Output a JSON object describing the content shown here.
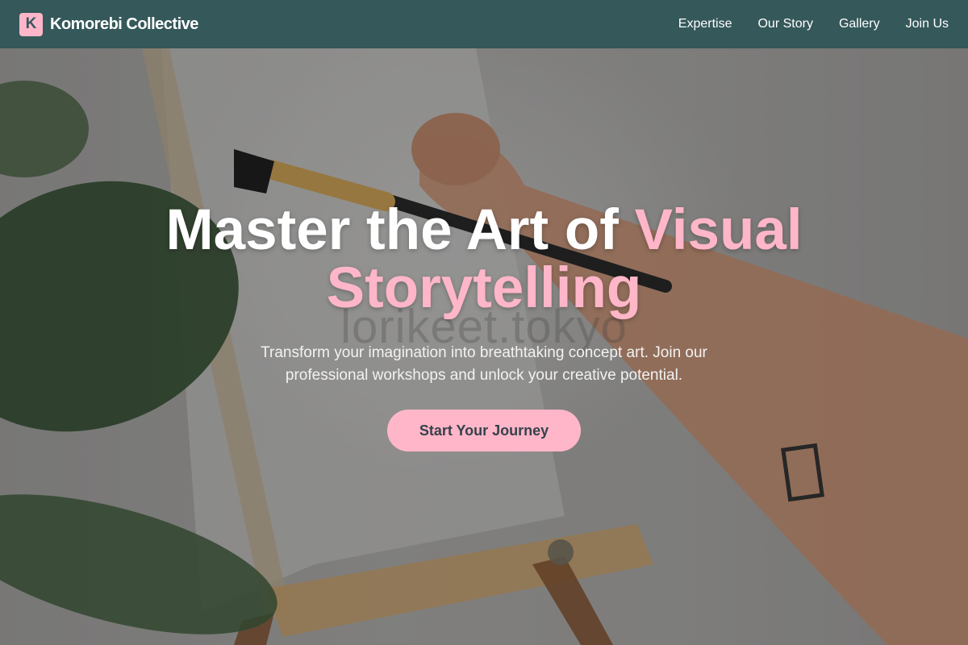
{
  "brand": {
    "badge_letter": "K",
    "name": "Komorebi Collective"
  },
  "nav": {
    "items": [
      {
        "label": "Expertise"
      },
      {
        "label": "Our Story"
      },
      {
        "label": "Gallery"
      },
      {
        "label": "Join Us"
      }
    ]
  },
  "hero": {
    "title_part1": "Master the Art of ",
    "title_accent_line1": "Visual",
    "title_accent_line2": "Storytelling",
    "subtitle": "Transform your imagination into breathtaking concept art. Join our professional workshops and unlock your creative potential.",
    "cta_label": "Start Your Journey",
    "watermark": "lorikeet.tokyo"
  },
  "colors": {
    "navbar": "#35585a",
    "accent_pink": "#ffb6c8",
    "title_white": "#ffffff"
  }
}
